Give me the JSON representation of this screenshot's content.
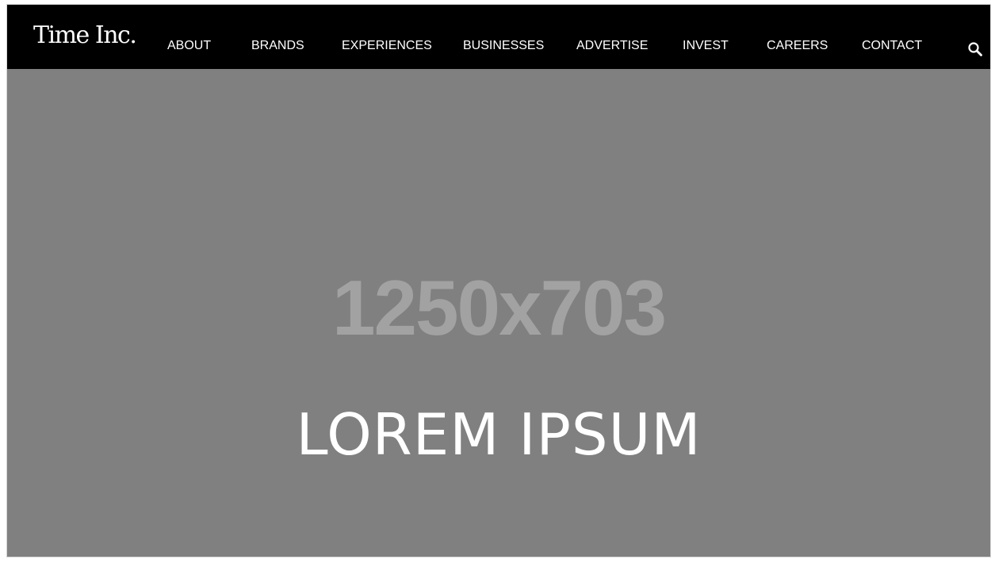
{
  "header": {
    "logo_text": "Time Inc.",
    "nav": [
      {
        "label": "ABOUT"
      },
      {
        "label": "BRANDS"
      },
      {
        "label": "EXPERIENCES"
      },
      {
        "label": "BUSINESSES"
      },
      {
        "label": "ADVERTISE"
      },
      {
        "label": "INVEST"
      },
      {
        "label": "CAREERS"
      },
      {
        "label": "CONTACT"
      }
    ],
    "search_icon": "search-icon"
  },
  "hero": {
    "placeholder_text": "1250x703",
    "title": "LOREM IPSUM"
  },
  "colors": {
    "nav_background": "#000000",
    "hero_background": "#808080",
    "placeholder_text": "#a2a2a2",
    "text_primary": "#ffffff"
  }
}
